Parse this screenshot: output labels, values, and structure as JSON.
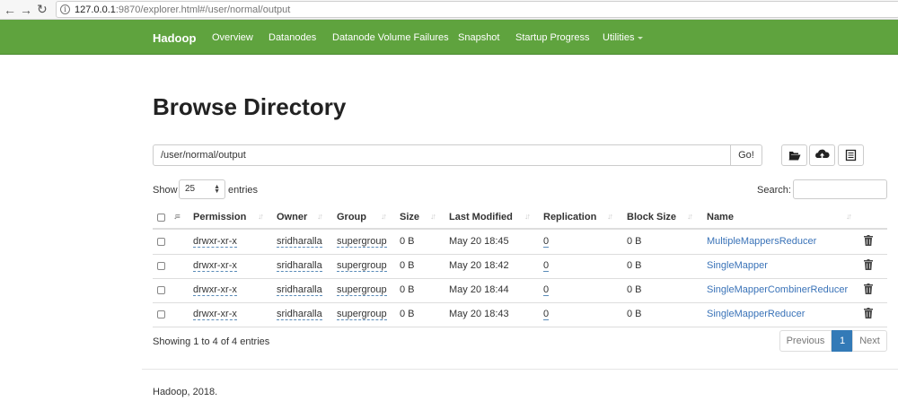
{
  "browser": {
    "url_host": "127.0.0.1",
    "url_rest": ":9870/explorer.html#/user/normal/output",
    "info_glyph": "i"
  },
  "navbar": {
    "brand": "Hadoop",
    "items": [
      "Overview",
      "Datanodes",
      "Datanode Volume Failures",
      "Snapshot",
      "Startup Progress",
      "Utilities"
    ]
  },
  "page": {
    "title": "Browse Directory",
    "path_value": "/user/normal/output",
    "go_label": "Go!"
  },
  "list_controls": {
    "show_label": "Show",
    "entries_value": "25",
    "entries_label": "entries",
    "search_label": "Search:"
  },
  "table": {
    "headers": [
      "Permission",
      "Owner",
      "Group",
      "Size",
      "Last Modified",
      "Replication",
      "Block Size",
      "Name"
    ],
    "rows": [
      {
        "permission": "drwxr-xr-x",
        "owner": "sridharalla",
        "group": "supergroup",
        "size": "0 B",
        "modified": "May 20 18:45",
        "replication": "0",
        "block_size": "0 B",
        "name": "MultipleMappersReducer"
      },
      {
        "permission": "drwxr-xr-x",
        "owner": "sridharalla",
        "group": "supergroup",
        "size": "0 B",
        "modified": "May 20 18:42",
        "replication": "0",
        "block_size": "0 B",
        "name": "SingleMapper"
      },
      {
        "permission": "drwxr-xr-x",
        "owner": "sridharalla",
        "group": "supergroup",
        "size": "0 B",
        "modified": "May 20 18:44",
        "replication": "0",
        "block_size": "0 B",
        "name": "SingleMapperCombinerReducer"
      },
      {
        "permission": "drwxr-xr-x",
        "owner": "sridharalla",
        "group": "supergroup",
        "size": "0 B",
        "modified": "May 20 18:43",
        "replication": "0",
        "block_size": "0 B",
        "name": "SingleMapperReducer"
      }
    ]
  },
  "summary": {
    "info": "Showing 1 to 4 of 4 entries",
    "previous": "Previous",
    "page": "1",
    "next": "Next"
  },
  "footer": {
    "text": "Hadoop, 2018."
  },
  "colors": {
    "navbar": "#5fa33e",
    "link": "#3a73b8",
    "active_page": "#337ab7"
  }
}
